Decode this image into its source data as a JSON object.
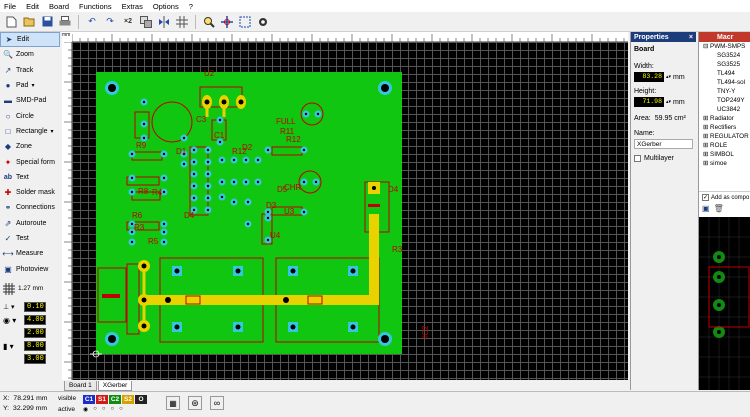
{
  "menu": [
    "File",
    "Edit",
    "Board",
    "Functions",
    "Extras",
    "Options",
    "?"
  ],
  "toolbar": {
    "icons": [
      "new-icon",
      "open-icon",
      "save-icon",
      "print-icon",
      "undo-icon",
      "redo-icon",
      "scale-x2-icon",
      "layers-icon",
      "mirror-icon",
      "grid-icon",
      "zoom-icon",
      "snap-icon",
      "select-icon",
      "drc-icon"
    ],
    "scale_label": "×2"
  },
  "tools": [
    {
      "label": "Edit",
      "icon": "arrow-icon",
      "active": true
    },
    {
      "label": "Zoom",
      "icon": "zoom-icon"
    },
    {
      "label": "Track",
      "icon": "track-icon"
    },
    {
      "label": "Pad",
      "icon": "pad-icon"
    },
    {
      "label": "SMD-Pad",
      "icon": "smd-pad-icon"
    },
    {
      "label": "Circle",
      "icon": "circle-icon"
    },
    {
      "label": "Rectangle",
      "icon": "rectangle-icon"
    },
    {
      "label": "Zone",
      "icon": "zone-icon"
    },
    {
      "label": "Special form",
      "icon": "special-form-icon"
    },
    {
      "label": "Text",
      "icon": "text-icon"
    },
    {
      "label": "Solder mask",
      "icon": "solder-mask-icon"
    },
    {
      "label": "Connections",
      "icon": "connections-icon"
    },
    {
      "label": "Autoroute",
      "icon": "autoroute-icon"
    },
    {
      "label": "Test",
      "icon": "test-icon"
    },
    {
      "label": "Measure",
      "icon": "measure-icon"
    },
    {
      "label": "Photoview",
      "icon": "photoview-icon"
    }
  ],
  "grid": {
    "value": "1.27 mm"
  },
  "track_widths": [
    "0.10",
    "4.00",
    "2.00",
    "8.00",
    "3.00"
  ],
  "ruler": {
    "unit": "mm"
  },
  "tabs": [
    "Board 1",
    "XGerber"
  ],
  "status": {
    "x_label": "X:",
    "x_value": "78.291 mm",
    "y_label": "Y:",
    "y_value": "32.299 mm",
    "visible_label": "visible",
    "active_label": "active",
    "layers": [
      {
        "name": "C1",
        "color": "#1c2fc8"
      },
      {
        "name": "S1",
        "color": "#d01818"
      },
      {
        "name": "C2",
        "color": "#118a11"
      },
      {
        "name": "S2",
        "color": "#d8a000"
      },
      {
        "name": "O",
        "color": "#222222"
      }
    ]
  },
  "properties": {
    "title": "Properties",
    "section": "Board",
    "width_label": "Width:",
    "width_value": "83.28",
    "width_unit": "mm",
    "height_label": "Height:",
    "height_value": "71.98",
    "height_unit": "mm",
    "area_label": "Area:",
    "area_value": "59.95 cm²",
    "name_label": "Name:",
    "name_value": "XGerber",
    "multilayer_label": "Multilayer",
    "multilayer_checked": false
  },
  "macros": {
    "title": "Macr",
    "items": [
      "PWM-SMPS",
      "SG3524",
      "SG3525",
      "TL494",
      "TL494-sol",
      "TNY-Y",
      "TOP249Y",
      "UC3842",
      "Radiator",
      "Rectifiers",
      "REGULATOR",
      "ROLE",
      "SIMBOL",
      "simoe"
    ],
    "add_label": "Add as compo"
  },
  "pcb": {
    "labels": [
      "U2",
      "C1",
      "R12",
      "R11",
      "D5",
      "R9",
      "R4",
      "R8",
      "R5",
      "R6",
      "R3",
      "D4",
      "U3",
      "U4",
      "D3",
      "D2",
      "D1",
      "C3",
      "FULL",
      "CHR",
      "R12",
      "D4",
      "IC2",
      "R3"
    ]
  },
  "colors": {
    "board": "#11c611",
    "track": "#e8d300",
    "silk": "#c00000",
    "pad": "#33c8e0"
  }
}
